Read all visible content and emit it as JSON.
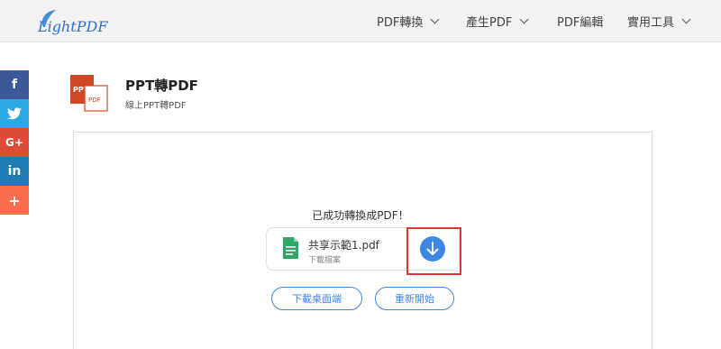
{
  "header": {
    "logo_text": "LightPDF",
    "nav": [
      {
        "label": "PDF轉換",
        "has_dropdown": true
      },
      {
        "label": "產生PDF",
        "has_dropdown": true
      },
      {
        "label": "PDF編輯",
        "has_dropdown": false
      },
      {
        "label": "實用工具",
        "has_dropdown": true
      }
    ]
  },
  "social": [
    {
      "icon": "facebook-icon",
      "glyph": "f",
      "color": "#3b5998"
    },
    {
      "icon": "twitter-icon",
      "glyph": "🐦",
      "color": "#29a9e1"
    },
    {
      "icon": "google-plus-icon",
      "glyph": "G+",
      "color": "#de4b39"
    },
    {
      "icon": "linkedin-icon",
      "glyph": "in",
      "color": "#1e7bb3"
    },
    {
      "icon": "more-share-icon",
      "glyph": "+",
      "color": "#fc6d4c"
    }
  ],
  "tool": {
    "title": "PPT轉PDF",
    "subtitle": "線上PPT轉PDF",
    "icon_labels": {
      "back": "PPT",
      "front": "PDF"
    }
  },
  "result": {
    "success_message": "已成功轉換成PDF！",
    "file_name": "共享示範1.pdf",
    "download_file_label": "下載檔案"
  },
  "buttons": {
    "desktop": "下載桌面端",
    "restart": "重新開始"
  },
  "colors": {
    "accent": "#3f87e2",
    "highlight": "#e2343a",
    "file_icon": "#2ea66a",
    "ppt_icon": "#d24726"
  }
}
